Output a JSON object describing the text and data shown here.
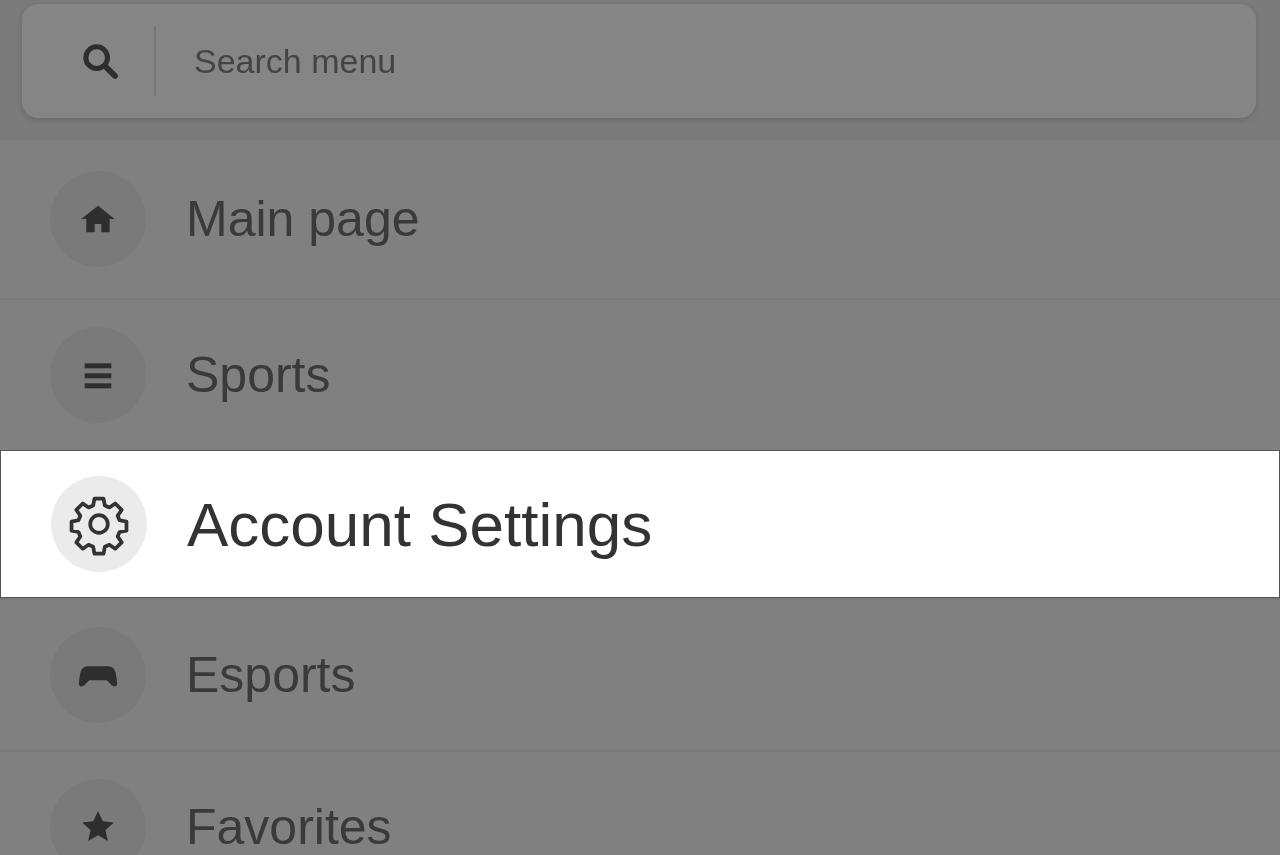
{
  "search": {
    "placeholder": "Search menu"
  },
  "menu_items": [
    {
      "label": "Main page",
      "selected": false
    },
    {
      "label": "Sports",
      "selected": false
    },
    {
      "label": "Account Settings",
      "selected": true
    },
    {
      "label": "Esports",
      "selected": false
    },
    {
      "label": "Favorites",
      "selected": false
    }
  ]
}
